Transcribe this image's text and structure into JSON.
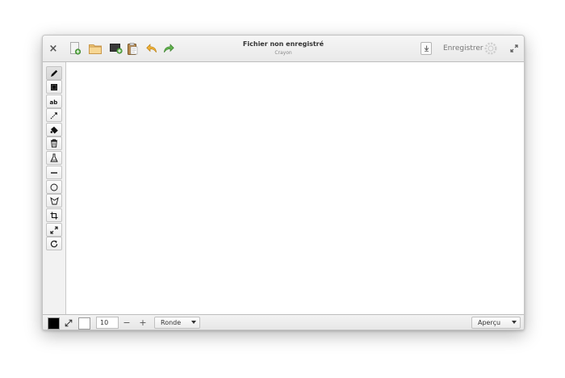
{
  "window": {
    "title": "Fichier non enregistré",
    "subtitle": "Crayon",
    "close_glyph": "×",
    "save_label": "Enregistrer"
  },
  "header_tools": [
    {
      "name": "new-image-icon"
    },
    {
      "name": "open-folder-icon"
    },
    {
      "name": "new-from-screenshot-icon"
    },
    {
      "name": "clipboard-icon"
    },
    {
      "name": "undo-icon"
    },
    {
      "name": "redo-icon"
    }
  ],
  "tools": [
    {
      "name": "pencil-tool"
    },
    {
      "name": "rectangle-select-tool"
    },
    {
      "name": "text-tool"
    },
    {
      "name": "line-arrow-tool"
    },
    {
      "name": "paint-bucket-tool"
    },
    {
      "name": "eraser-tool"
    },
    {
      "name": "filter-tool"
    },
    {
      "name": "line-tool"
    },
    {
      "name": "circle-tool"
    },
    {
      "name": "free-shape-tool"
    },
    {
      "name": "crop-tool"
    },
    {
      "name": "scale-tool"
    },
    {
      "name": "rotate-tool"
    }
  ],
  "bottom": {
    "size_value": "10",
    "minus": "−",
    "plus": "+",
    "shape_option": "Ronde",
    "preview_label": "Aperçu"
  },
  "colors": {
    "primary": "#000000",
    "secondary": "#ffffff",
    "folder": "#e8b860",
    "undo": "#e8a317",
    "redo": "#4aa23a",
    "new_green": "#58a845"
  }
}
